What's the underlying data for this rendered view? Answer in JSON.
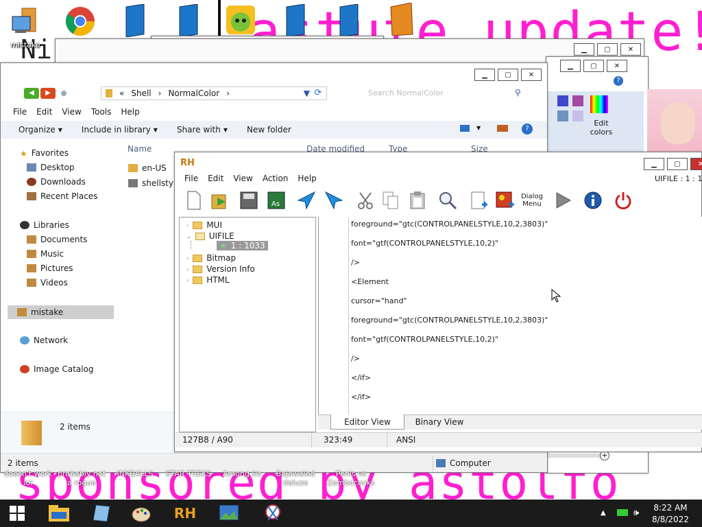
{
  "desktop": {
    "banner_text": "astute update!",
    "banner_prefix": "Ni",
    "sponsor_text": "sponsored by astolfo",
    "icon_labels_top": [
      "mistake"
    ],
    "icon_labels_bottom": [
      "doesn't work lol",
      "probably not a rogue",
      "INKBALLS",
      "STAR TREKS",
      "Among Us",
      "Bejeweled deluze",
      "Penis vs Zombococks"
    ]
  },
  "explorer": {
    "address": [
      "Shell",
      "NormalColor"
    ],
    "address_prefix": "«",
    "search_placeholder": "Search NormalColor",
    "menu": [
      "File",
      "Edit",
      "View",
      "Tools",
      "Help"
    ],
    "toolbar": {
      "organize": "Organize",
      "include": "Include in library",
      "share": "Share with",
      "newfolder": "New folder"
    },
    "columns": {
      "name": "Name",
      "date": "Date modified",
      "type": "Type",
      "size": "Size"
    },
    "files": [
      "en-US",
      "shellstyle"
    ],
    "nav": {
      "favorites": "Favorites",
      "desktop": "Desktop",
      "downloads": "Downloads",
      "recent": "Recent Places",
      "libraries": "Libraries",
      "documents": "Documents",
      "music": "Music",
      "pictures": "Pictures",
      "videos": "Videos",
      "mistake": "mistake",
      "network": "Network",
      "catalog": "Image Catalog"
    },
    "details": "2 items",
    "status": "2 items",
    "status_computer": "Computer"
  },
  "paint": {
    "edit_colors": "Edit colors"
  },
  "rh": {
    "title_logo": "RH",
    "title_right": "UIFILE : 1 : 1033",
    "menu": [
      "File",
      "Edit",
      "View",
      "Action",
      "Help"
    ],
    "dialog_btn": "Dialog Menu",
    "tree": {
      "mui": "MUI",
      "uifile": "UIFILE",
      "entry": "1 : 1033",
      "bitmap": "Bitmap",
      "version": "Version Info",
      "html": "HTML"
    },
    "code_lines": [
      "foreground=\"gtc(CONTROLPANELSTYLE,10,2,3803)\"",
      "font=\"gtf(CONTROLPANELSTYLE,10,2)\"",
      "/>",
      "<Element",
      "cursor=\"hand\"",
      "foreground=\"gtc(CONTROLPANELSTYLE,10,2,3803)\"",
      "font=\"gtf(CONTROLPANELSTYLE,10,2)\"",
      "/>",
      "</if>",
      "</if>"
    ],
    "tabs": {
      "editor": "Editor View",
      "binary": "Binary View"
    },
    "status": {
      "offset": "127B8 / A90",
      "pos": "323:49",
      "enc": "ANSI"
    }
  },
  "taskbar": {
    "time": "8:22 AM",
    "date": "8/8/2022"
  },
  "colors": {
    "banner": "#ff1fd0",
    "taskbar": "#1b1b1b",
    "rh_tab_active": "#ffffff",
    "selected_nav": "#d0d0d0"
  }
}
